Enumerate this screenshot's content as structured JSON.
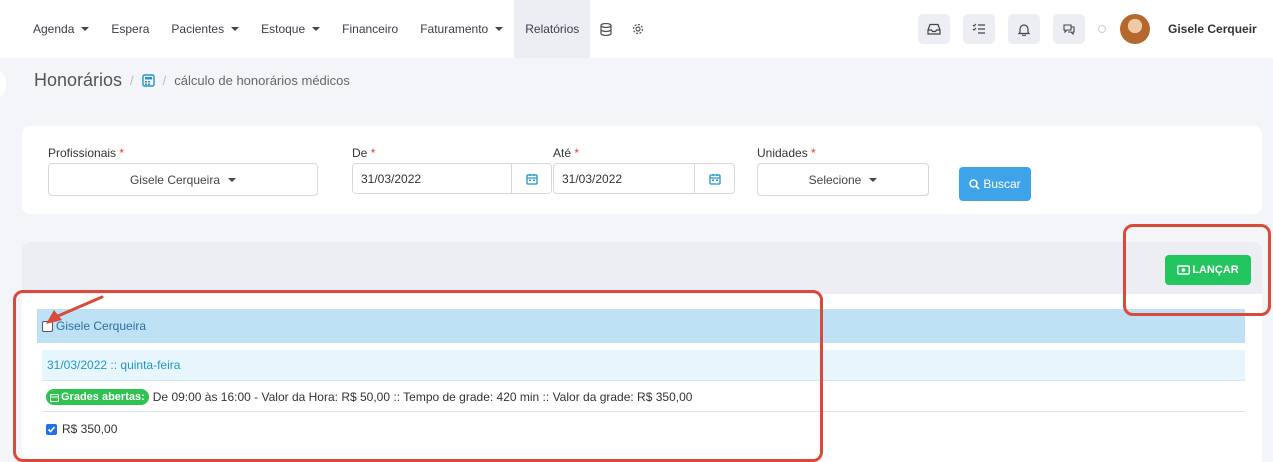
{
  "nav": {
    "items": [
      {
        "label": "Agenda",
        "caret": true
      },
      {
        "label": "Espera",
        "caret": false
      },
      {
        "label": "Pacientes",
        "caret": true
      },
      {
        "label": "Estoque",
        "caret": true
      },
      {
        "label": "Financeiro",
        "caret": false
      },
      {
        "label": "Faturamento",
        "caret": true
      },
      {
        "label": "Relatórios",
        "caret": false,
        "active": true
      }
    ],
    "icons": [
      "database-icon",
      "settings-icon"
    ],
    "right_icons": [
      "inbox-icon",
      "tasks-icon",
      "bell-icon",
      "chat-icon"
    ],
    "user_name": "Gisele Cerqueir"
  },
  "breadcrumb": {
    "title": "Honorários",
    "separator": "/",
    "page": "cálculo de honorários médicos"
  },
  "filters": {
    "profissionais": {
      "label": "Profissionais",
      "required": "*",
      "value": "Gisele Cerqueira"
    },
    "de": {
      "label": "De",
      "required": "*",
      "value": "31/03/2022"
    },
    "ate": {
      "label": "Até",
      "required": "*",
      "value": "31/03/2022"
    },
    "unidades": {
      "label": "Unidades",
      "required": "*",
      "value": "Selecione"
    },
    "search_button": "Buscar"
  },
  "results": {
    "launch_button": "LANÇAR",
    "professional": "Gisele Cerqueira",
    "date_header": "31/03/2022 :: quinta-feira",
    "grade_badge": "Grades abertas:",
    "grade_text": "De 09:00 às 16:00 - Valor da Hora: R$ 50,00 :: Tempo de grade: 420 min :: Valor da grade: R$ 350,00",
    "value": "R$ 350,00",
    "value_checked": true,
    "professional_checked": false
  },
  "colors": {
    "accent": "#3ea3e8",
    "launch": "#22c55e",
    "annotation": "#d94a3a",
    "badge": "#2ec24f"
  }
}
